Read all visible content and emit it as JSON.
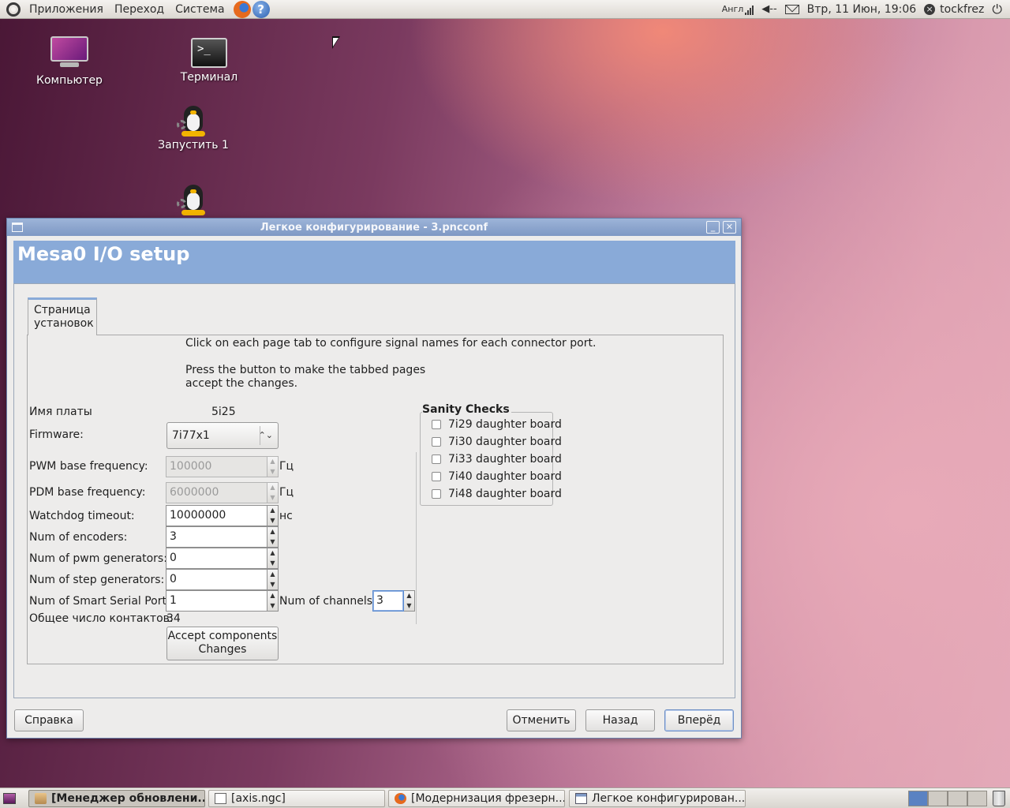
{
  "top_panel": {
    "menus": [
      "Приложения",
      "Переход",
      "Система"
    ],
    "keyboard_layout": "Англ",
    "clock": "Втр, 11 Июн, 19:06",
    "user": "tockfrez"
  },
  "desktop_icons": [
    {
      "label": "Компьютер",
      "icon": "computer-icon"
    },
    {
      "label": "Терминал",
      "icon": "terminal-icon"
    },
    {
      "label": "Запустить 1",
      "icon": "launcher-penguin-icon"
    },
    {
      "label": "",
      "icon": "launcher-penguin-icon"
    }
  ],
  "dialog": {
    "title": "Легкое конфигурирование - 3.pncconf",
    "banner": "Mesa0 I/O setup",
    "tab_label": "Страница установок",
    "info_line1": "Click on each page tab to configure signal names for each connector port.",
    "info_line2": "Press the button to make the tabbed pages",
    "info_line3": "accept the changes.",
    "board_label": "Имя платы",
    "board_value": "5i25",
    "firmware_label": "Firmware:",
    "firmware_value": "7i77x1",
    "pwm_label": "PWM base frequency:",
    "pwm_value": "100000",
    "pwm_unit": "Гц",
    "pdm_label": "PDM base frequency:",
    "pdm_value": "6000000",
    "pdm_unit": "Гц",
    "watchdog_label": "Watchdog timeout:",
    "watchdog_value": "10000000",
    "watchdog_unit": "нс",
    "encoders_label": "Num of encoders:",
    "encoders_value": "3",
    "pwmgen_label": "Num of pwm generators:",
    "pwmgen_value": "0",
    "stepgen_label": "Num of step generators:",
    "stepgen_value": "0",
    "sserial_label": "Num of Smart Serial Ports:",
    "sserial_value": "1",
    "channels_label": "Num of channels:",
    "channels_value": "3",
    "total_pins_label": "Общее число контактов:",
    "total_pins_value": "34",
    "accept_line1": "Accept  components",
    "accept_line2": "Changes",
    "sanity_title": "Sanity Checks",
    "sanity_items": [
      "7i29 daughter board",
      "7i30 daughter board",
      "7i33 daughter board",
      "7i40 daughter board",
      "7i48 daughter board"
    ],
    "help_button": "Справка",
    "cancel_button": "Отменить",
    "back_button": "Назад",
    "forward_button": "Вперёд"
  },
  "taskbar": {
    "tasks": [
      {
        "label": "[Менеджер обновлени...",
        "active": true
      },
      {
        "label": "[axis.ngc]",
        "active": false
      },
      {
        "label": "[Модернизация фрезерн...",
        "active": false
      },
      {
        "label": "Легкое конфигурирован...",
        "active": false
      }
    ]
  }
}
